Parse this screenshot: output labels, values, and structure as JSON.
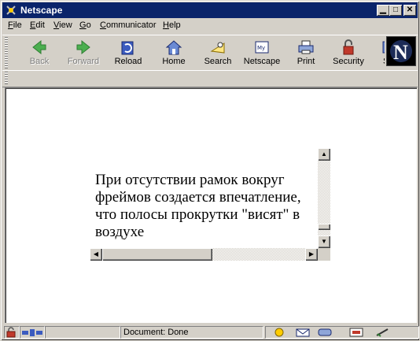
{
  "window": {
    "title": "Netscape"
  },
  "menu": [
    {
      "label": "File",
      "key": "F",
      "rest": "ile"
    },
    {
      "label": "Edit",
      "key": "E",
      "rest": "dit"
    },
    {
      "label": "View",
      "key": "V",
      "rest": "iew"
    },
    {
      "label": "Go",
      "key": "G",
      "rest": "o"
    },
    {
      "label": "Communicator",
      "key": "C",
      "rest": "ommunicator"
    },
    {
      "label": "Help",
      "key": "H",
      "rest": "elp"
    }
  ],
  "toolbar": {
    "back": "Back",
    "forward": "Forward",
    "reload": "Reload",
    "home": "Home",
    "search": "Search",
    "netscape": "Netscape",
    "print": "Print",
    "security": "Security",
    "shop": "S"
  },
  "frame": {
    "text": "При отсутствии рамок вокруг фреймов создается впечатление, что полосы прокрутки \"висят\" в воздухе"
  },
  "status": {
    "text": "Document: Done"
  },
  "icons": [
    "app-icon",
    "minimize-icon",
    "maximize-icon",
    "close-icon",
    "back-icon",
    "forward-icon",
    "reload-icon",
    "home-icon",
    "search-icon",
    "netscape-icon",
    "print-icon",
    "security-icon",
    "netscape-logo",
    "lock-icon",
    "connection-icon",
    "navigator-icon",
    "mail-icon",
    "discussion-icon",
    "composer-icon",
    "edit-icon"
  ],
  "colors": {
    "titlebar": "#0a246a",
    "chrome": "#d4d0c8",
    "content": "#ffffff"
  }
}
